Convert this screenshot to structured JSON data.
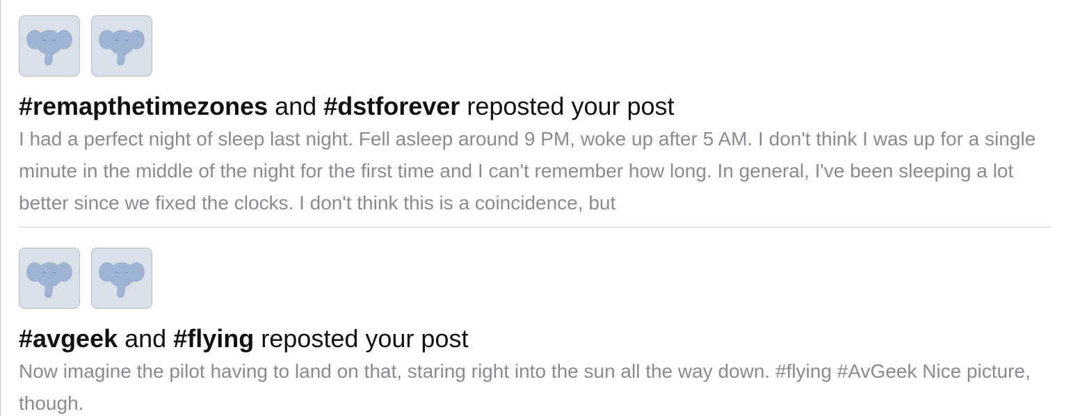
{
  "colors": {
    "avatar_background": "#d9e0e8",
    "avatar_elephant": "#9fb3d3",
    "headline_text": "#111111",
    "excerpt_text": "#8a8a8f",
    "divider": "#d1d1d6"
  },
  "notifications": [
    {
      "avatars": [
        "elephant-avatar-icon",
        "elephant-avatar-icon"
      ],
      "actor1": "#remapthetimezones",
      "conjunction": "and",
      "actor2": "#dstforever",
      "action": "reposted your post",
      "excerpt": "I had a perfect night of sleep last night. Fell asleep around 9 PM, woke up after 5 AM. I don't think I was up for a single minute in the middle of the night for the first time and I can't remember how long. In general, I've been sleeping a lot better since we fixed the clocks. I don't think this is a coincidence, but"
    },
    {
      "avatars": [
        "elephant-avatar-icon",
        "elephant-avatar-icon"
      ],
      "actor1": "#avgeek",
      "conjunction": "and",
      "actor2": "#flying",
      "action": "reposted your post",
      "excerpt": "Now imagine the pilot having to land on that, staring right into the sun all the way down. #flying #AvGeek  Nice picture, though."
    }
  ]
}
